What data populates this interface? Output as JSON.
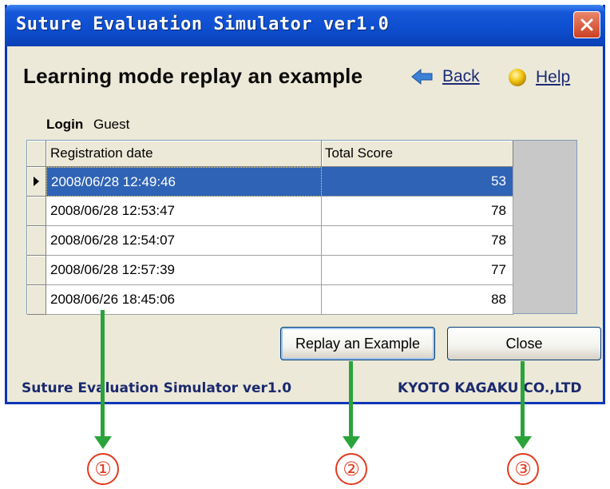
{
  "window": {
    "title": "Suture Evaluation Simulator ver1.0"
  },
  "page": {
    "heading": "Learning mode replay an example"
  },
  "nav": {
    "back": {
      "label": "Back",
      "icon": "arrow-left-icon"
    },
    "help": {
      "label": "Help",
      "icon": "help-orb-icon"
    }
  },
  "login": {
    "label": "Login",
    "user": "Guest"
  },
  "grid": {
    "columns": [
      "Registration date",
      "Total Score"
    ],
    "rows": [
      {
        "date": "2008/06/28 12:49:46",
        "score": "53"
      },
      {
        "date": "2008/06/28 12:53:47",
        "score": "78"
      },
      {
        "date": "2008/06/28 12:54:07",
        "score": "78"
      },
      {
        "date": "2008/06/28 12:57:39",
        "score": "77"
      },
      {
        "date": "2008/06/26 18:45:06",
        "score": "88"
      }
    ]
  },
  "buttons": {
    "replay": "Replay an Example",
    "close": "Close"
  },
  "footer": {
    "left": "Suture Evaluation Simulator ver1.0",
    "right": "KYOTO KAGAKU CO.,LTD"
  },
  "annotations": [
    "①",
    "②",
    "③"
  ],
  "colors": {
    "titlebar": "#0d4fd0",
    "selection": "#2f63b5",
    "annotation_arrow": "#2aa43a",
    "annotation_marker": "#e23a1e"
  }
}
